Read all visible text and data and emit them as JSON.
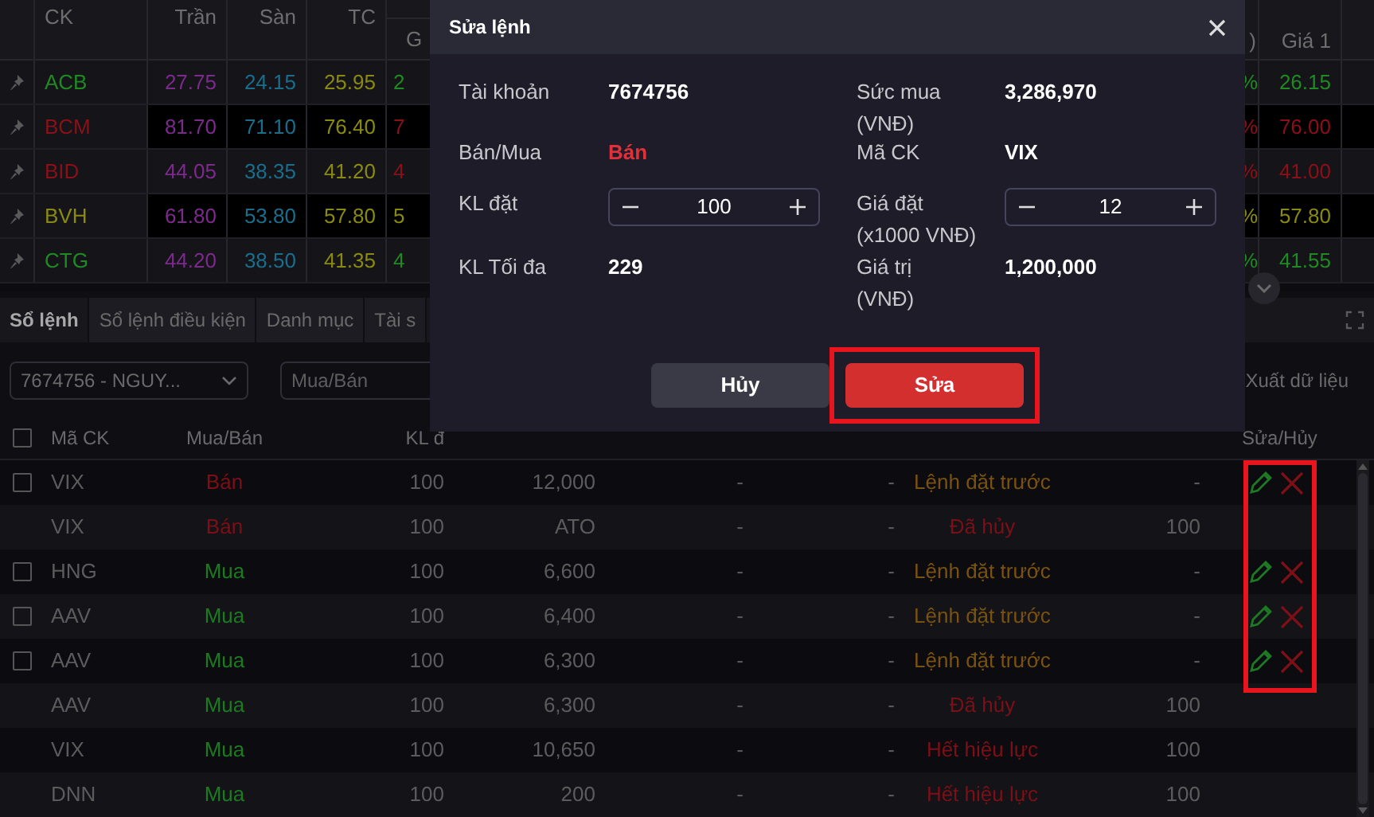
{
  "price_board": {
    "columns": [
      "CK",
      "Trần",
      "Sàn",
      "TC"
    ],
    "group_column": "G",
    "change_column": ")",
    "bid_column": "Giá 1",
    "rows": [
      {
        "symbol": "ACB",
        "color": "#1f8a22",
        "ceiling": "27.75",
        "floor": "24.15",
        "ref": "25.95",
        "partial": "2",
        "change": "%",
        "bid": "26.15"
      },
      {
        "symbol": "BCM",
        "color": "#8c1018",
        "ceiling": "81.70",
        "floor": "71.10",
        "ref": "76.40",
        "partial": "7",
        "change": "%",
        "bid": "76.00"
      },
      {
        "symbol": "BID",
        "color": "#8c1018",
        "ceiling": "44.05",
        "floor": "38.35",
        "ref": "41.20",
        "partial": "4",
        "change": "%",
        "bid": "41.00"
      },
      {
        "symbol": "BVH",
        "color": "#8a8a12",
        "ceiling": "61.80",
        "floor": "53.80",
        "ref": "57.80",
        "partial": "5",
        "change": "%",
        "bid": "57.80"
      },
      {
        "symbol": "CTG",
        "color": "#1f8a22",
        "ceiling": "44.20",
        "floor": "38.50",
        "ref": "41.35",
        "partial": "4",
        "change": "%",
        "bid": "41.55"
      }
    ]
  },
  "tabs": [
    {
      "label": "Sổ lệnh",
      "selected": true
    },
    {
      "label": "Sổ lệnh điều kiện",
      "selected": false
    },
    {
      "label": "Danh mục",
      "selected": false
    },
    {
      "label": "Tài s",
      "selected": false
    }
  ],
  "filters": {
    "account": "7674756 - NGUY...",
    "side_placeholder": "Mua/Bán",
    "export": "Xuất dữ liệu"
  },
  "orders": {
    "columns": {
      "symbol": "Mã CK",
      "side": "Mua/Bán",
      "qty": "KL đ",
      "actions": "Sửa/Hủy"
    },
    "select_all_checked": false,
    "actions_highlighted": true,
    "rows": [
      {
        "selectable": true,
        "checked": false,
        "symbol": "VIX",
        "side": {
          "text": "Bán",
          "color": "#7c1016"
        },
        "qty": "100",
        "price": "12,000",
        "col_5": "-",
        "col_6": "-",
        "status": {
          "text": "Lệnh đặt trước",
          "color": "#7a5210"
        },
        "col_9": "-",
        "editable": true
      },
      {
        "selectable": false,
        "symbol": "VIX",
        "side": {
          "text": "Bán",
          "color": "#7c1016"
        },
        "qty": "100",
        "price": "ATO",
        "col_5": "-",
        "col_6": "-",
        "status": {
          "text": "Đã hủy",
          "color": "#7c1016"
        },
        "col_9": "100",
        "editable": false
      },
      {
        "selectable": true,
        "checked": false,
        "symbol": "HNG",
        "side": {
          "text": "Mua",
          "color": "#1d7a22"
        },
        "qty": "100",
        "price": "6,600",
        "col_5": "-",
        "col_6": "-",
        "status": {
          "text": "Lệnh đặt trước",
          "color": "#7a5210"
        },
        "col_9": "-",
        "editable": true
      },
      {
        "selectable": true,
        "checked": false,
        "symbol": "AAV",
        "side": {
          "text": "Mua",
          "color": "#1d7a22"
        },
        "qty": "100",
        "price": "6,400",
        "col_5": "-",
        "col_6": "-",
        "status": {
          "text": "Lệnh đặt trước",
          "color": "#7a5210"
        },
        "col_9": "-",
        "editable": true
      },
      {
        "selectable": true,
        "checked": false,
        "symbol": "AAV",
        "side": {
          "text": "Mua",
          "color": "#1d7a22"
        },
        "qty": "100",
        "price": "6,300",
        "col_5": "-",
        "col_6": "-",
        "status": {
          "text": "Lệnh đặt trước",
          "color": "#7a5210"
        },
        "col_9": "-",
        "editable": true
      },
      {
        "selectable": false,
        "symbol": "AAV",
        "side": {
          "text": "Mua",
          "color": "#1d7a22"
        },
        "qty": "100",
        "price": "6,300",
        "col_5": "-",
        "col_6": "-",
        "status": {
          "text": "Đã hủy",
          "color": "#7c1016"
        },
        "col_9": "100",
        "editable": false
      },
      {
        "selectable": false,
        "symbol": "VIX",
        "side": {
          "text": "Mua",
          "color": "#1d7a22"
        },
        "qty": "100",
        "price": "10,650",
        "col_5": "-",
        "col_6": "-",
        "status": {
          "text": "Hết hiệu lực",
          "color": "#7c1016"
        },
        "col_9": "100",
        "editable": false
      },
      {
        "selectable": false,
        "symbol": "DNN",
        "side": {
          "text": "Mua",
          "color": "#1d7a22"
        },
        "qty": "100",
        "price": "200",
        "col_5": "-",
        "col_6": "-",
        "status": {
          "text": "Hết hiệu lực",
          "color": "#7c1016"
        },
        "col_9": "100",
        "editable": false
      }
    ]
  },
  "modal": {
    "title": "Sửa lệnh",
    "fields": [
      {
        "kind": "text",
        "label": "Tài khoản",
        "value": "7674756"
      },
      {
        "kind": "text",
        "label": "Sức mua\n(VNĐ)",
        "value": "3,286,970"
      },
      {
        "kind": "side",
        "label": "Bán/Mua",
        "value": "Bán"
      },
      {
        "kind": "text",
        "label": "Mã CK",
        "value": "VIX"
      },
      {
        "kind": "stepper",
        "label": "KL đặt",
        "value": "100"
      },
      {
        "kind": "stepper",
        "label": "Giá đặt\n(x1000 VNĐ)",
        "value": "12"
      },
      {
        "kind": "text",
        "label": "KL Tối đa",
        "value": "229"
      },
      {
        "kind": "text",
        "label": "Giá trị\n(VNĐ)",
        "value": "1,200,000"
      }
    ],
    "buttons": [
      {
        "label": "Hủy",
        "kind": "cancel",
        "highlighted": false
      },
      {
        "label": "Sửa",
        "kind": "confirm",
        "highlighted": true
      }
    ]
  }
}
